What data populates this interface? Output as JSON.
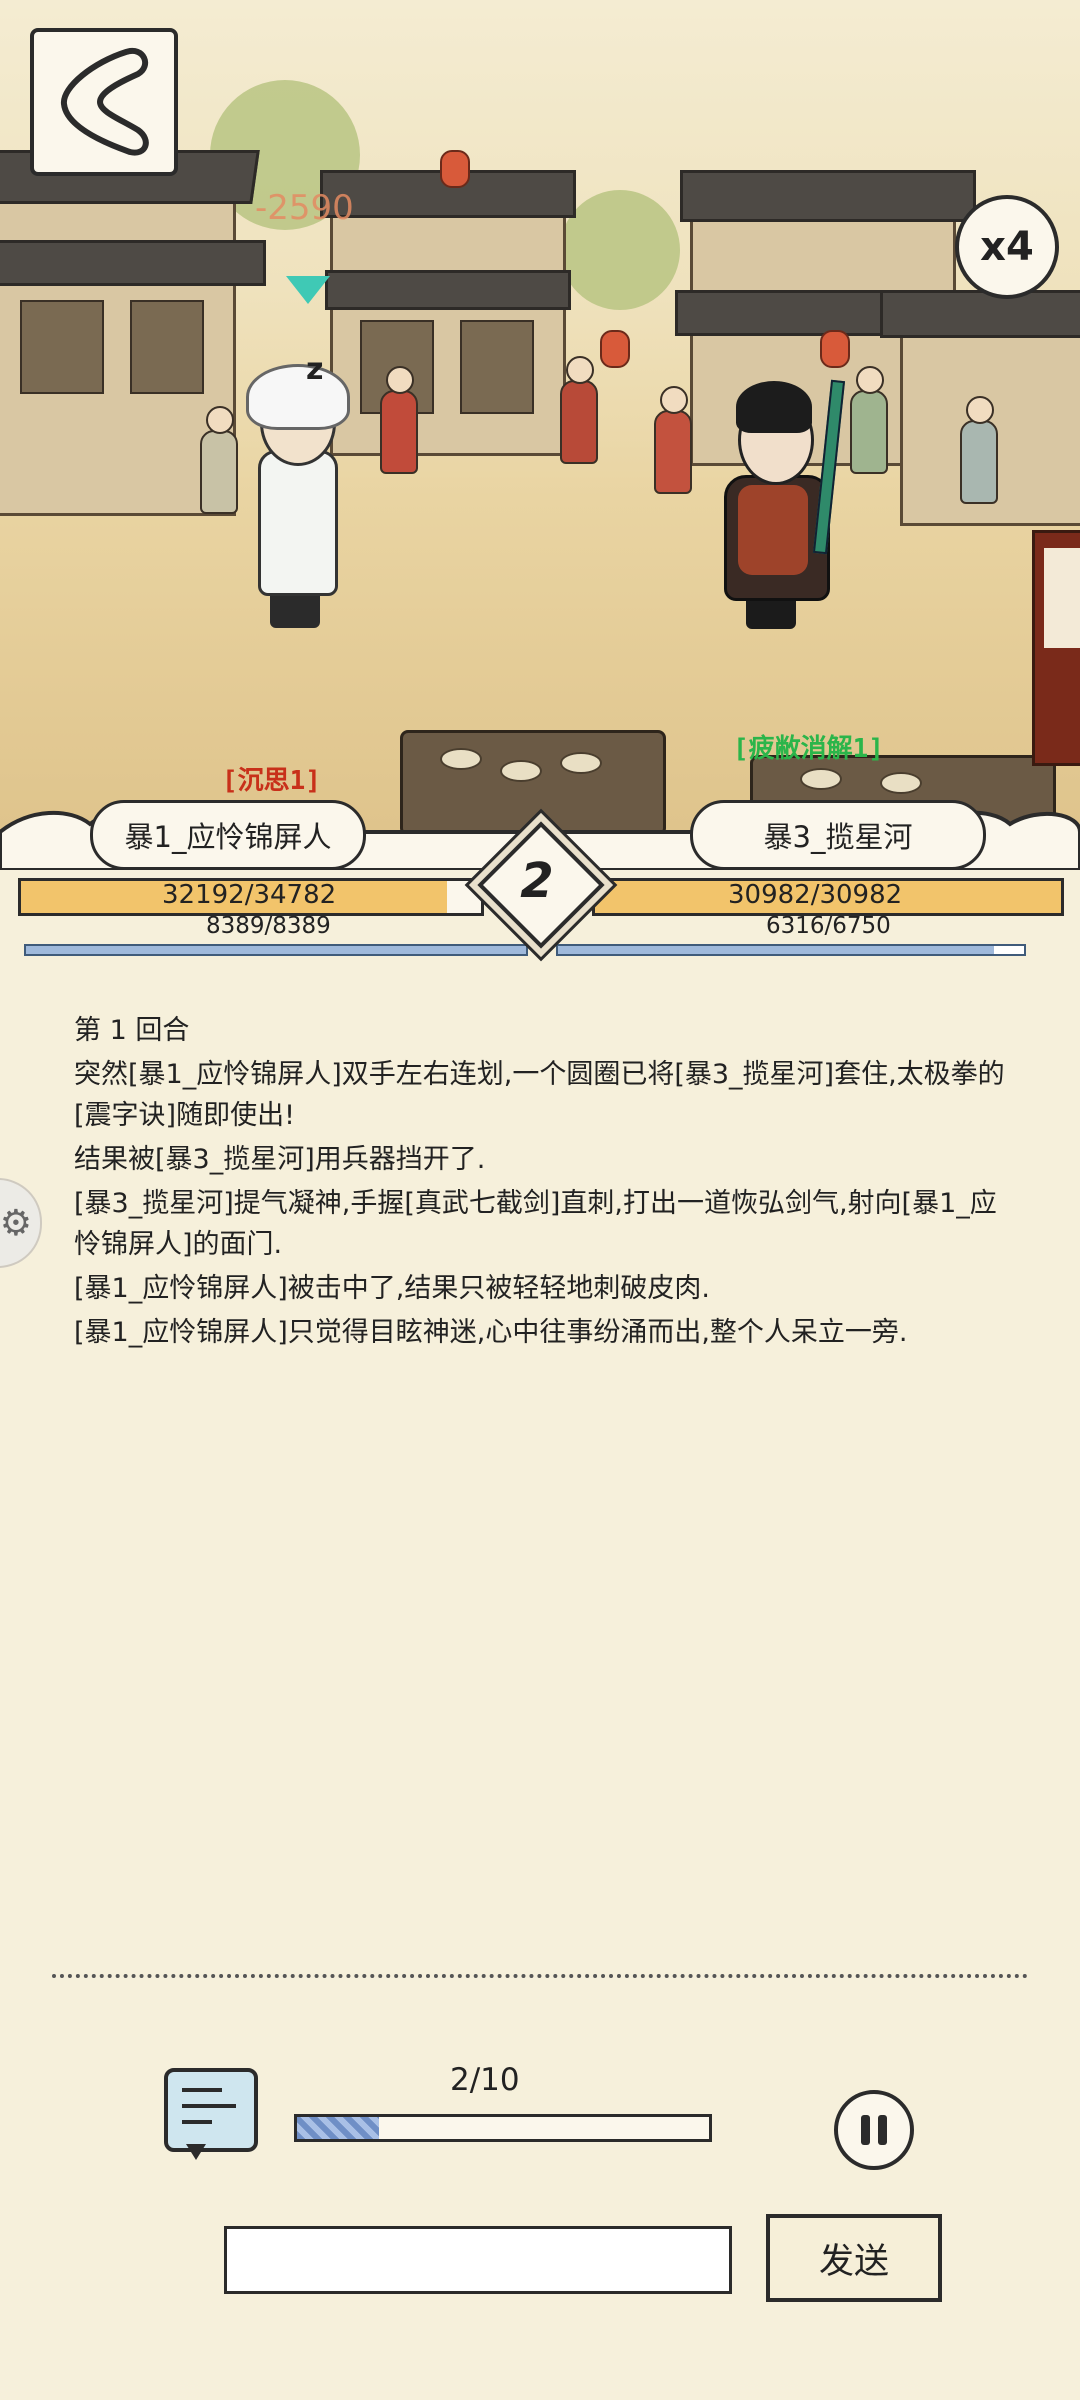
{
  "battle": {
    "damage_popup": "-2590",
    "speed_label": "x4",
    "left": {
      "name": "暴1_应怜锦屏人",
      "status": "[沉思1]",
      "hp_current": 32192,
      "hp_max": 34782,
      "hp_text": "32192/34782",
      "mp_current": 8389,
      "mp_max": 8389,
      "mp_text": "8389/8389"
    },
    "right": {
      "name": "暴3_揽星河",
      "status": "[疲敝消解1]",
      "hp_current": 30982,
      "hp_max": 30982,
      "hp_text": "30982/30982",
      "mp_current": 6316,
      "mp_max": 6750,
      "mp_text": "6316/6750"
    },
    "round": "2"
  },
  "log": [
    "第 1 回合",
    "突然[暴1_应怜锦屏人]双手左右连划,一个圆圈已将[暴3_揽星河]套住,太极拳的[震字诀]随即使出!",
    "结果被[暴3_揽星河]用兵器挡开了.",
    "[暴3_揽星河]提气凝神,手握[真武七截剑]直刺,打出一道恢弘剑气,射向[暴1_应怜锦屏人]的面门.",
    "[暴1_应怜锦屏人]被击中了,结果只被轻轻地刺破皮肉.",
    "[暴1_应怜锦屏人]只觉得目眩神迷,心中往事纷涌而出,整个人呆立一旁."
  ],
  "progress": {
    "label": "2/10",
    "current": 2,
    "total": 10
  },
  "chat": {
    "input_value": "",
    "send_label": "发送"
  },
  "icons": {
    "back": "back-arrow-icon",
    "speed": "speed-x4-icon",
    "target": "target-marker-icon",
    "chat": "chat-icon",
    "pause": "pause-icon",
    "gear": "gear-icon"
  },
  "colors": {
    "hp": "#f2c46b",
    "mp": "#9fb9db",
    "status_debuff": "#c8301a",
    "status_buff": "#2bb54a",
    "target": "#3fc9b5"
  }
}
